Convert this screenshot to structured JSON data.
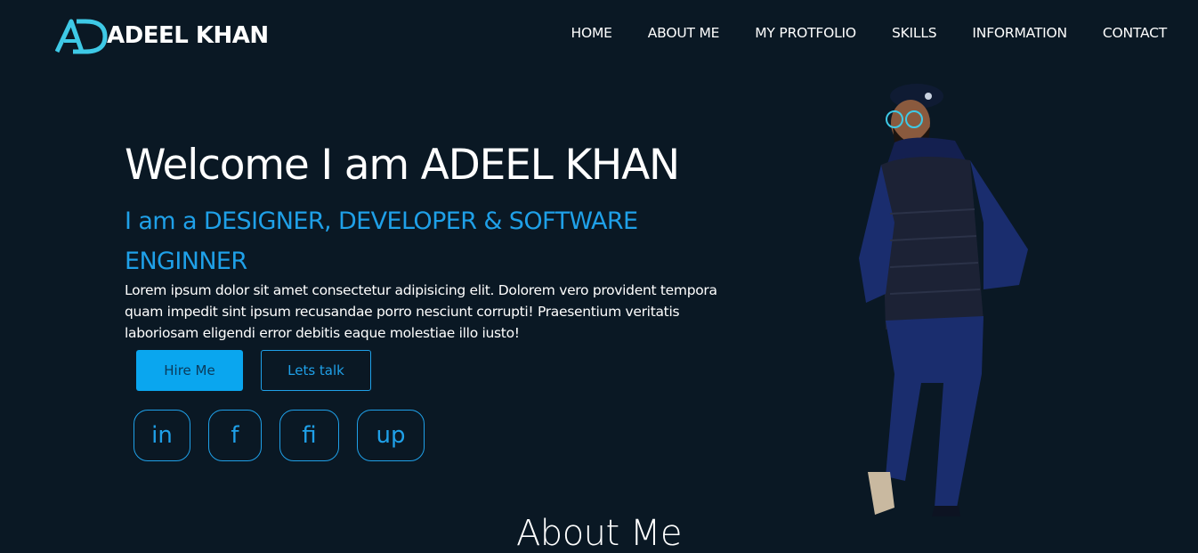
{
  "header": {
    "logo_text": "ADEEL KHAN",
    "nav": [
      "HOME",
      "ABOUT ME",
      "MY PROTFOLIO",
      "SKILLS",
      "INFORMATION",
      "CONTACT"
    ]
  },
  "hero": {
    "title": "Welcome I am ADEEL KHAN",
    "subtitle": "I am a DESIGNER, DEVELOPER & SOFTWARE ENGINNER",
    "text": "Lorem ipsum dolor sit amet consectetur adipisicing elit. Dolorem vero provident tempora quam impedit sint ipsum recusandae porro nesciunt corrupti! Praesentium veritatis laboriosam eligendi error debitis eaque molestiae illo iusto!",
    "hire_label": "Hire Me",
    "talk_label": "Lets talk",
    "social": [
      "in",
      "f",
      "fi",
      "up"
    ]
  },
  "about": {
    "heading": "About Me"
  },
  "colors": {
    "background": "#0a1824",
    "accent": "#1fa0e8",
    "button_fill": "#0aa6ef",
    "logo_accent": "#3ec9e6"
  },
  "icons": {
    "logo": "ad-monogram-icon",
    "photo": "person-photo"
  }
}
